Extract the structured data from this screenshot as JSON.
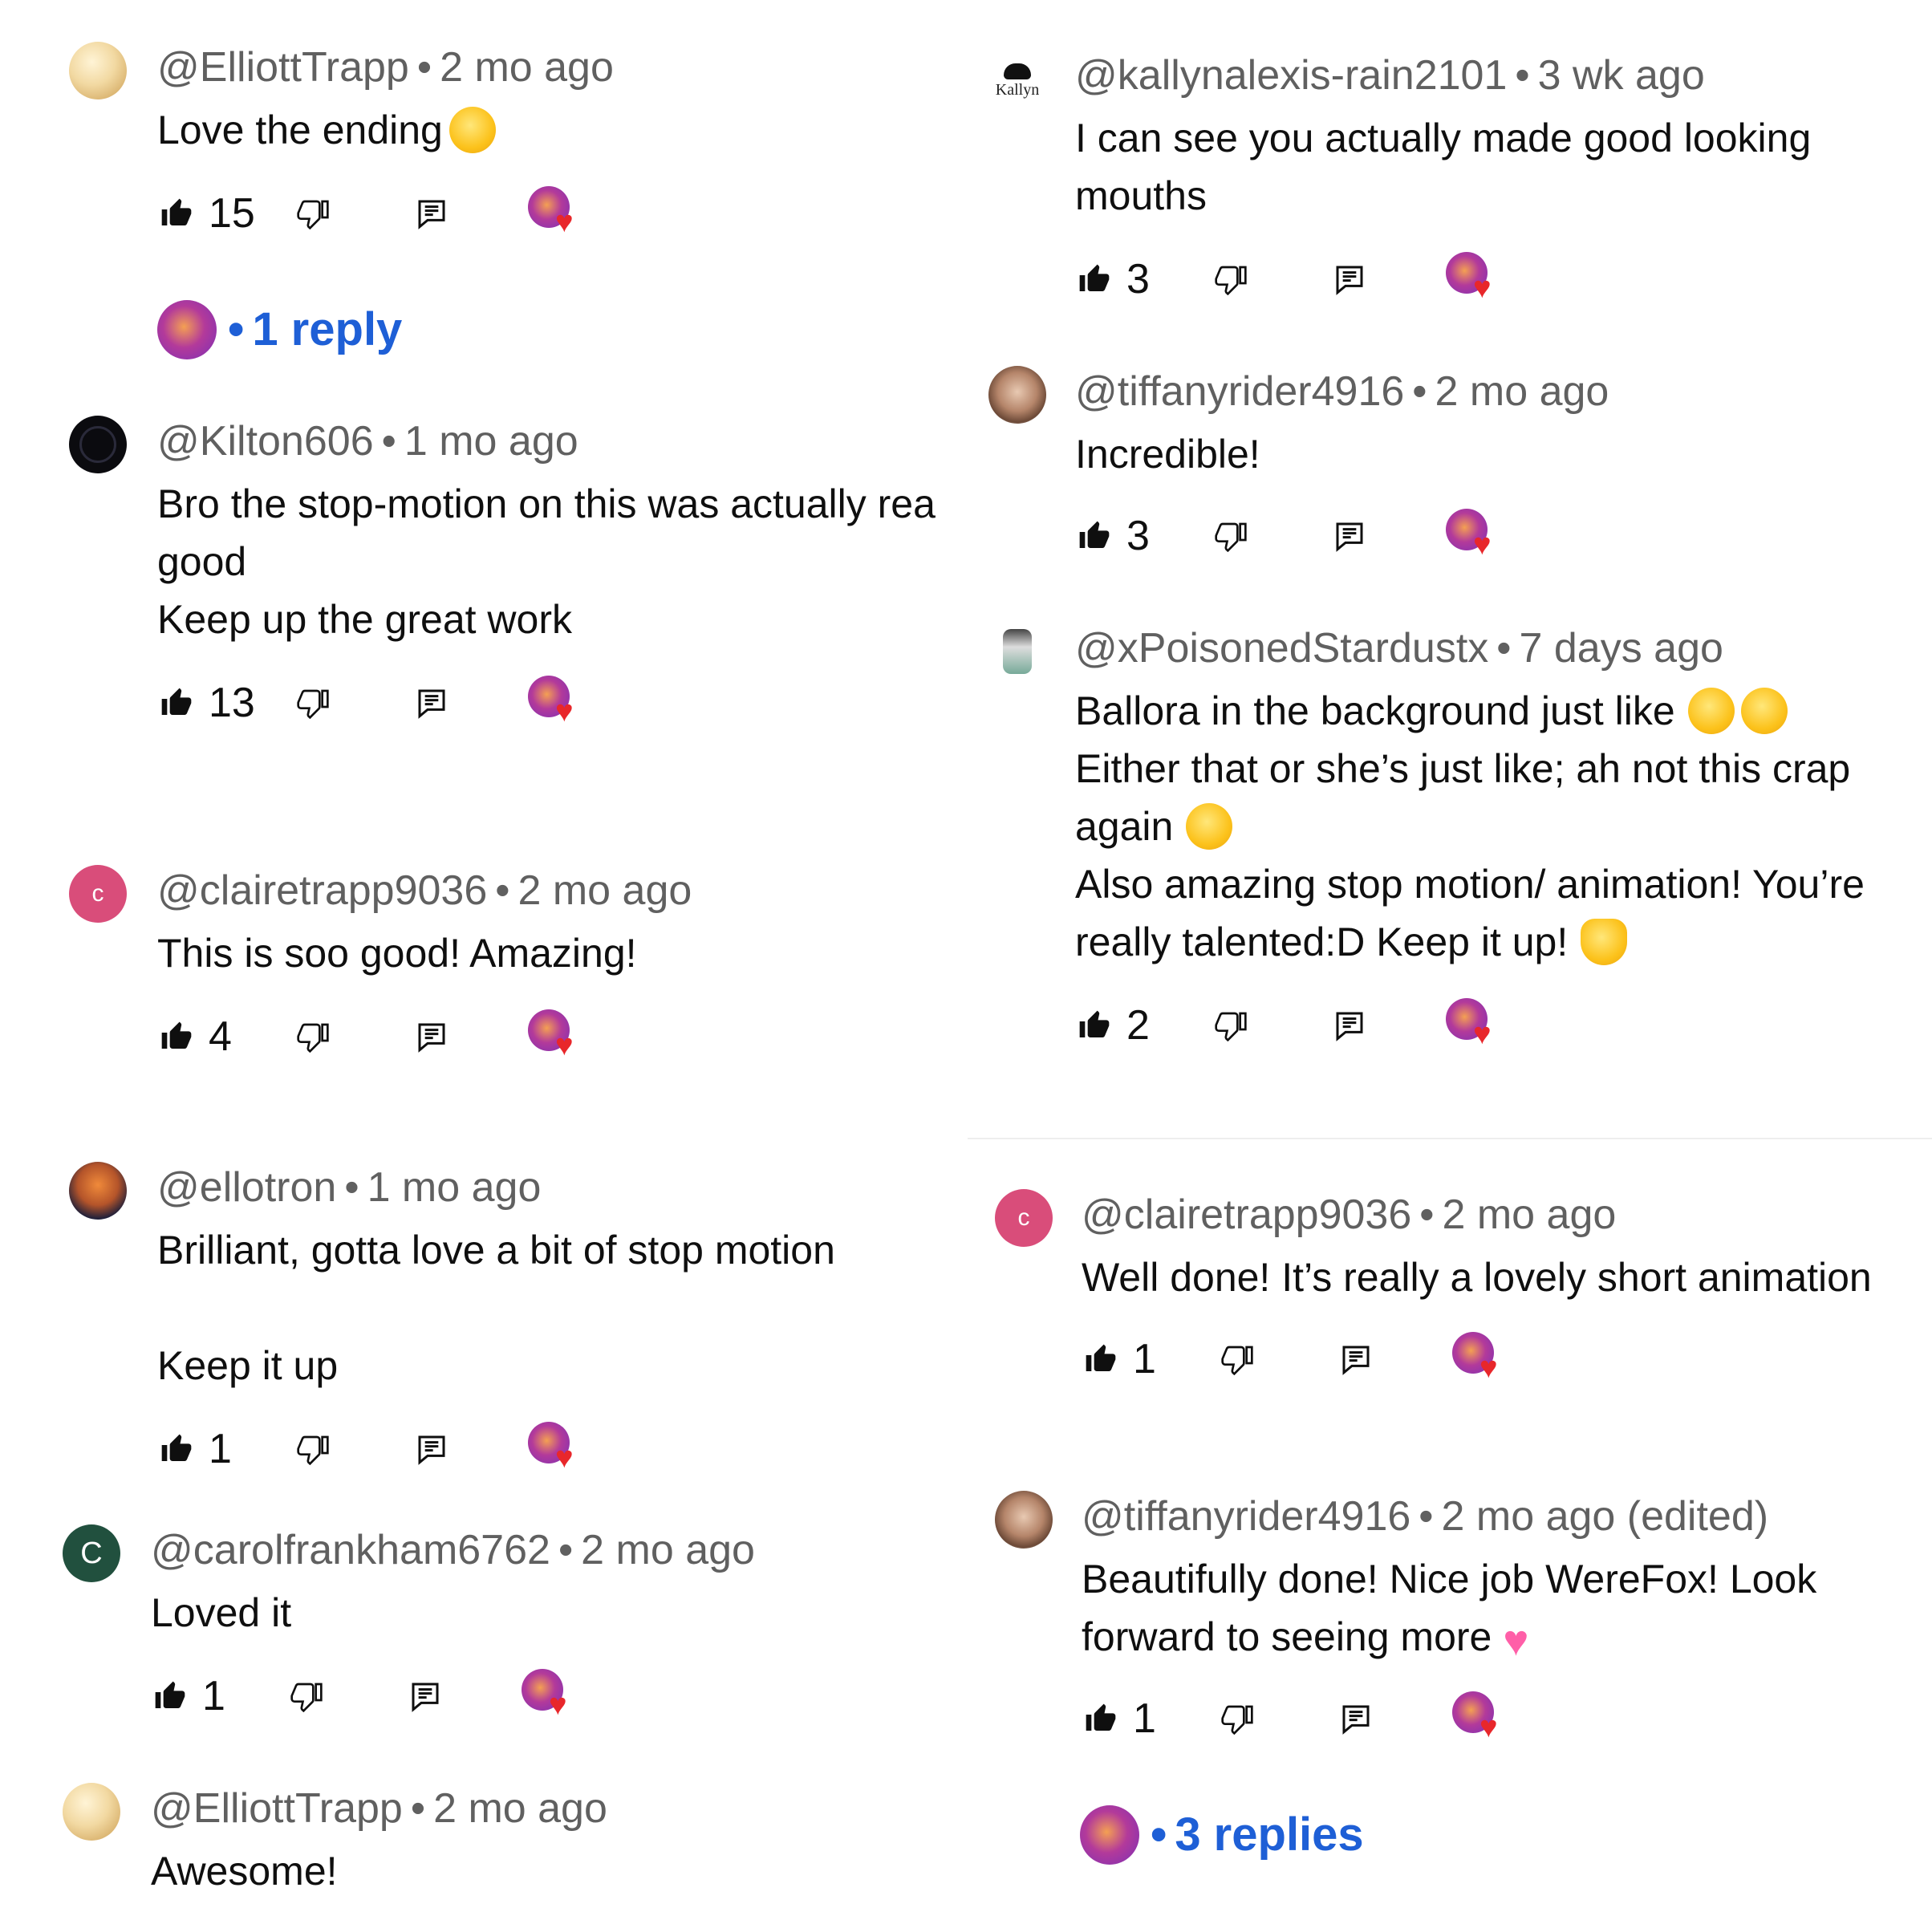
{
  "left_column": [
    {
      "handle": "@ElliottTrapp",
      "time": "2 mo ago",
      "text": "Love the ending",
      "emoji": "tears-of-joy",
      "likes": "15",
      "avatar": "gold-circle",
      "replies": "1 reply"
    },
    {
      "handle": "@Kilton606",
      "time": "1 mo ago",
      "text": "Bro the stop-motion on this was actually rea\ngood\nKeep up the great work",
      "likes": "13",
      "avatar": "dark-mask"
    },
    {
      "handle": "@clairetrapp9036",
      "time": "2 mo ago",
      "text": "This is soo good! Amazing!",
      "likes": "4",
      "avatar": "letter",
      "avatar_letter": "c"
    },
    {
      "handle": "@ellotron",
      "time": "1 mo ago",
      "text": "Brilliant, gotta love a bit of stop motion\n\nKeep it up",
      "likes": "1",
      "avatar": "orange-dragon"
    },
    {
      "handle": "@carolfrankham6762",
      "time": "2 mo ago",
      "text": "Loved it",
      "likes": "1",
      "avatar": "letter",
      "avatar_letter": "C"
    },
    {
      "handle": "@ElliottTrapp",
      "time": "2 mo ago",
      "text": "Awesome!",
      "avatar": "gold-circle"
    }
  ],
  "right_column": [
    {
      "handle": "@kallynalexis-rain2101",
      "time": "3 wk ago",
      "text": "I can see you actually made good looking\nmouths",
      "likes": "3",
      "avatar": "kallyn-logo",
      "avatar_text": "Kallyn"
    },
    {
      "handle": "@tiffanyrider4916",
      "time": "2 mo ago",
      "text": "Incredible!",
      "likes": "3",
      "avatar": "photo"
    },
    {
      "handle": "@xPoisonedStardustx",
      "time": "7 days ago",
      "line1": "Ballora in the background just like",
      "line2": "Either that or she’s just like; ah not this crap",
      "line3": "again",
      "line4": "Also amazing stop motion/ animation! You’re",
      "line5": "really talented:D Keep it up!",
      "likes": "2",
      "avatar": "figure"
    },
    {
      "handle": "@clairetrapp9036",
      "time": "2 mo ago",
      "text": "Well done! It’s really a lovely short animation",
      "likes": "1",
      "avatar": "letter",
      "avatar_letter": "c"
    },
    {
      "handle": "@tiffanyrider4916",
      "time": "2 mo ago (edited)",
      "line1": "Beautifully done! Nice job WereFox! Look",
      "line2": "forward to seeing more",
      "likes": "1",
      "avatar": "photo",
      "replies": "3 replies"
    }
  ],
  "separator": "•",
  "colors": {
    "meta_gray": "#606060",
    "reply_link_blue": "#1e5fd6",
    "creator_heart_red": "#e8272b",
    "letter_avatar_pink": "#d94d7a",
    "letter_avatar_green": "#21503e"
  },
  "icons": [
    "thumbs-up-icon",
    "thumbs-down-icon",
    "reply-icon",
    "creator-heart-icon"
  ]
}
